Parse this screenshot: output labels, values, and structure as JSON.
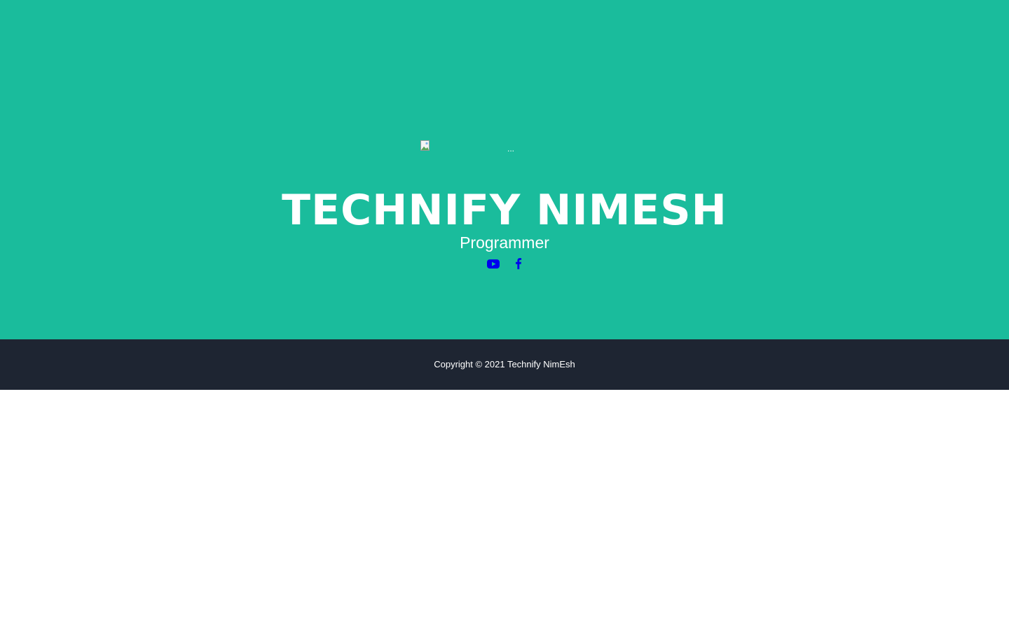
{
  "masthead": {
    "background_color": "#1abc9c",
    "avatar": {
      "alt_text": "...",
      "icon": "broken-image-icon"
    },
    "heading": "TECHNIFY NIMESH",
    "subheading": "Programmer",
    "social_links": [
      {
        "name": "youtube",
        "icon": "youtube-icon",
        "color": "#0000ee"
      },
      {
        "name": "facebook",
        "icon": "facebook-icon",
        "color": "#0000ee"
      }
    ]
  },
  "footer": {
    "background_color": "#1e2532",
    "copyright": "Copyright © 2021 Technify NimEsh"
  }
}
